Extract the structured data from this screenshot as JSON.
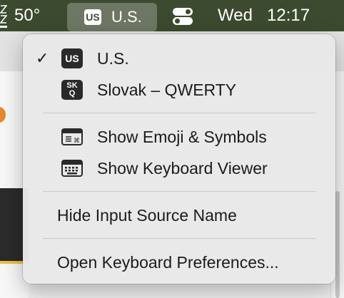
{
  "menubar": {
    "temperature": "50°",
    "input_source_badge": "US",
    "input_source_label": "U.S.",
    "day": "Wed",
    "time": "12:17",
    "bg_color": "#3c4a2f"
  },
  "input_menu": {
    "sources": [
      {
        "badge": "US",
        "label": "U.S.",
        "checked": true,
        "check_glyph": "✓"
      },
      {
        "badge_top": "SK",
        "badge_bottom": "Q",
        "label": "Slovak – QWERTY",
        "checked": false
      }
    ],
    "actions": [
      {
        "label": "Show Emoji & Symbols",
        "icon": "emoji-symbols-icon"
      },
      {
        "label": "Show Keyboard Viewer",
        "icon": "keyboard-icon"
      }
    ],
    "hide_name_label": "Hide Input Source Name",
    "open_prefs_label": "Open Keyboard Preferences..."
  }
}
